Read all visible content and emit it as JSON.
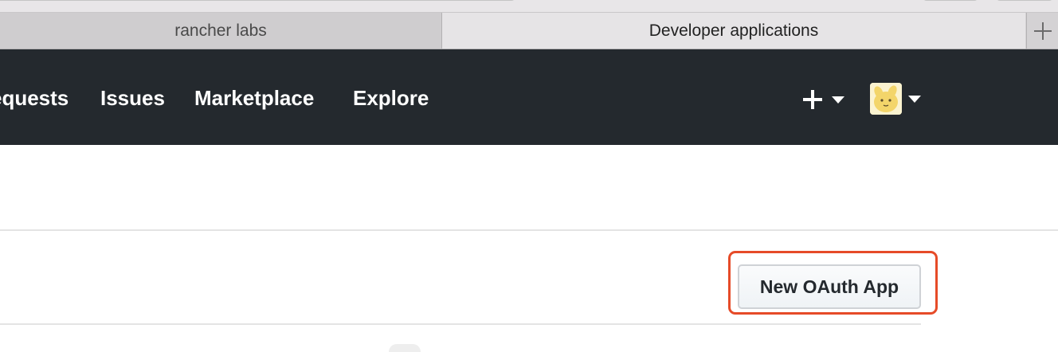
{
  "browser": {
    "tabs": [
      {
        "label": "rancher labs",
        "active": false
      },
      {
        "label": "Developer applications",
        "active": true
      }
    ],
    "new_tab_icon": "plus-icon"
  },
  "header": {
    "nav": [
      "equests",
      "Issues",
      "Marketplace",
      "Explore"
    ],
    "create_icon": "plus-icon",
    "avatar_icon": "user-avatar"
  },
  "main": {
    "new_app_button": "New OAuth App"
  },
  "colors": {
    "header_bg": "#24292e",
    "highlight": "#e64b28"
  }
}
